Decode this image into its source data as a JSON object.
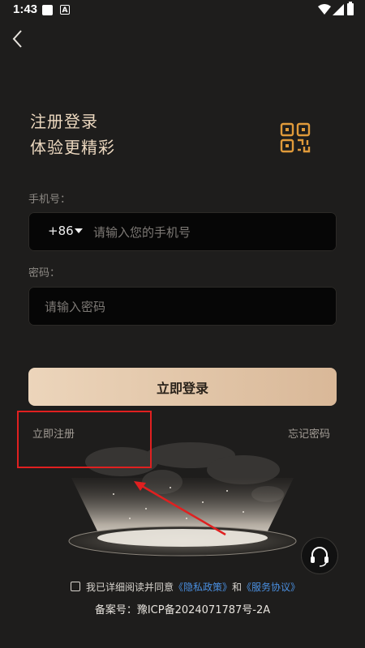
{
  "status_bar": {
    "time": "1:43",
    "notif_icon": "A"
  },
  "header": {
    "back_icon": "chevron-left-icon"
  },
  "hero": {
    "title_line1": "注册登录",
    "title_line2": "体验更精彩",
    "qr_icon": "qr-code-icon"
  },
  "form": {
    "phone_label": "手机号：",
    "country_code": "+86",
    "phone_placeholder": "请输入您的手机号",
    "password_label": "密码：",
    "password_placeholder": "请输入密码"
  },
  "actions": {
    "login": "立即登录",
    "register": "立即注册",
    "forgot": "忘记密码"
  },
  "footer": {
    "agree_prefix": "我已详细阅读并同意",
    "privacy": "《隐私政策》",
    "and": "和",
    "terms": "《服务协议》",
    "icp": "备案号：豫ICP备2024071787号-2A"
  },
  "colors": {
    "accent_gold": "#ecd5bb",
    "link_blue": "#4a8fe0",
    "annotation_red": "#e02020"
  }
}
